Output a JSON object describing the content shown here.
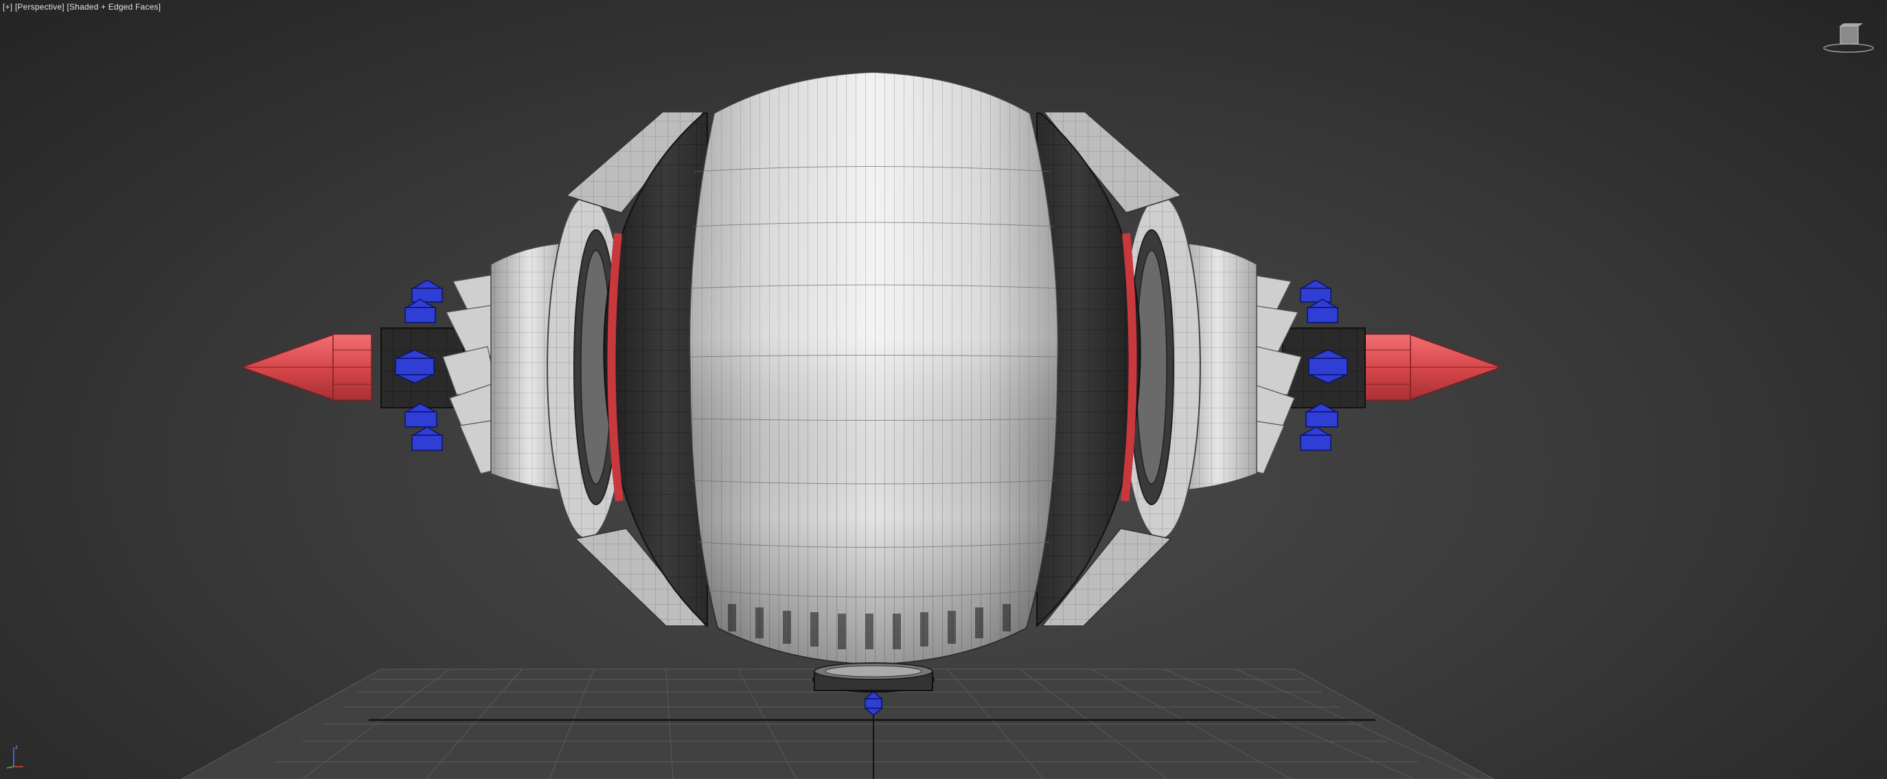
{
  "viewport": {
    "label_menu": "[+]",
    "label_view": "[Perspective]",
    "label_shading": "[Shaded + Edged Faces]",
    "axis_label": "z"
  },
  "colors": {
    "background_center": "#4a4a4a",
    "background_edge": "#242424",
    "mesh_light": "#d8d8d8",
    "mesh_dark": "#2e2e2e",
    "accent_red": "#d8484c",
    "gizmo_blue": "#2f3fd6",
    "grid_line": "#5c5c5c",
    "axis_x": "#d44",
    "axis_y": "#3c3",
    "axis_z": "#37f"
  },
  "icons": {
    "viewcube": "viewcube-icon",
    "axis_tripod": "axis-tripod-icon",
    "helper_gizmo": "helper-gizmo-icon"
  }
}
